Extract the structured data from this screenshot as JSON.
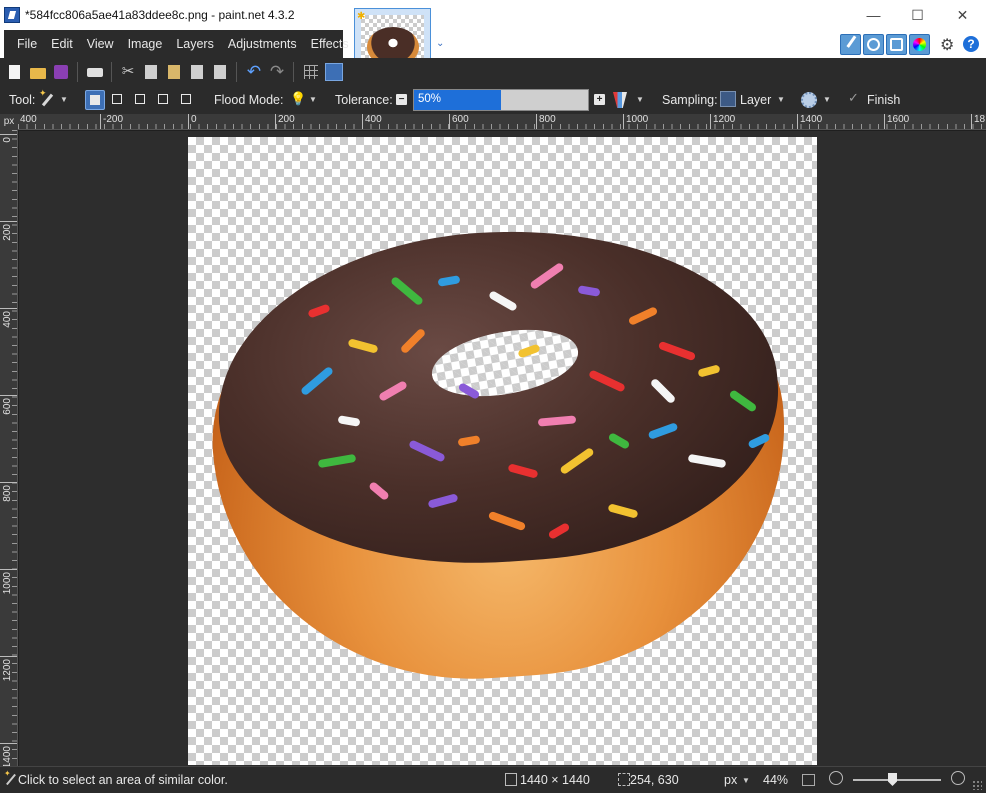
{
  "window": {
    "title": "*584fcc806a5ae41a83ddee8c.png - paint.net 4.3.2",
    "minimize": "—",
    "maximize": "☐",
    "close": "✕"
  },
  "menu": {
    "items": [
      "File",
      "Edit",
      "View",
      "Image",
      "Layers",
      "Adjustments",
      "Effects"
    ]
  },
  "options": {
    "tool_label": "Tool:",
    "flood_mode_label": "Flood Mode:",
    "tolerance_label": "Tolerance:",
    "tolerance_value": "50%",
    "tolerance_fraction": 0.5,
    "minus": "−",
    "plus": "+",
    "sampling_label": "Sampling:",
    "sampling_value": "Layer",
    "finish_label": "Finish",
    "check": "✓",
    "chevron": "▼",
    "bulb": "💡"
  },
  "rulers": {
    "unit": "px",
    "horizontal": [
      "400",
      "-200",
      "0",
      "200",
      "400",
      "600",
      "800",
      "1000",
      "1200",
      "1400",
      "1600",
      "18"
    ],
    "vertical": [
      "0",
      "200",
      "400",
      "600",
      "800",
      "1000",
      "1200",
      "1400"
    ]
  },
  "status": {
    "hint": "Click to select an area of similar color.",
    "image_size": "1440 × 1440",
    "cursor_pos": "254, 630",
    "units": "px",
    "zoom": "44%"
  },
  "toolbar": {
    "settings_icon": "⚙",
    "help_icon": "?",
    "undo": "↶",
    "redo": "↷",
    "cut": "✂",
    "thumb_chevron": "⌄",
    "thumb_star": "✱"
  }
}
